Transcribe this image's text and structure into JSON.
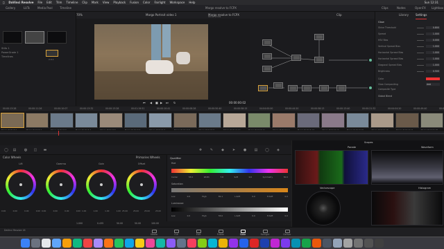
{
  "menubar": {
    "app": "DaVinci Resolve",
    "items": [
      "File",
      "Edit",
      "Trim",
      "Timeline",
      "Clip",
      "Mark",
      "View",
      "Playback",
      "Fusion",
      "Color",
      "Fairlight",
      "Workspace",
      "Help"
    ],
    "clock": "Sun 12:31"
  },
  "window_title": "Margo resolve to FCPX",
  "toolbar": {
    "gallery": "Gallery",
    "luts": "LUTs",
    "media_pool": "Media Pool",
    "timeline": "Timeline",
    "clips": "Clips",
    "nodes": "Nodes",
    "openfx": "OpenFX",
    "lightbox": "Lightbox"
  },
  "viewer": {
    "zoom": "70%",
    "clip_name": "Margo Portrait video 1",
    "timecode_top": "00:01:13:29",
    "timecode": "00:00:00:02",
    "clip_label": "Clip"
  },
  "gallery": {
    "stills_label": "Stills 1",
    "items": [
      "PowerGrade 1",
      "Timelines"
    ],
    "clip_code": "2.0.1"
  },
  "settings": {
    "tab_library": "Library",
    "tab_settings": "Settings",
    "filter": "Glow",
    "rows": [
      {
        "label": "Shine Threshold",
        "value": "0.800"
      },
      {
        "label": "Spread",
        "value": "1.000"
      },
      {
        "label": "HSV Bias",
        "value": "0.000"
      },
      {
        "label": "Vertical Spread Bias",
        "value": "1.000"
      },
      {
        "label": "Horizontal Spread Bias",
        "value": "1.000"
      },
      {
        "label": "Horizontal Spread Bias",
        "value": "1.000"
      },
      {
        "label": "Diagonal Spread Bias",
        "value": "1.000"
      },
      {
        "label": "Brightness",
        "value": "0.500"
      }
    ],
    "color_label": "Color",
    "composite_label": "Glow Compositing",
    "composite_value": "Add",
    "blend_label": "Composite Type",
    "global_blend": "Global Blend"
  },
  "timeline_clips": [
    {
      "tc": "00:00:13:28",
      "name": "Margo Portrait 1"
    },
    {
      "tc": "00:00:11:26",
      "name": "Margo Portrait 2"
    },
    {
      "tc": "00:00:10:07",
      "name": "Margo Portrait 3"
    },
    {
      "tc": "00:00:13:32",
      "name": "Margo Portrait 4"
    },
    {
      "tc": "00:00:13:28",
      "name": "Margo Portrait 5"
    },
    {
      "tc": "00:01:19:51",
      "name": "Margo Portrait 6"
    },
    {
      "tc": "00:00:10:41",
      "name": "Margo Portrait 7"
    },
    {
      "tc": "00:00:08:28",
      "name": "Margo Portrait 8"
    },
    {
      "tc": "00:00:50:40",
      "name": "Margo Portrait 9"
    },
    {
      "tc": "00:00:58:15",
      "name": "Margo Portrait 10"
    },
    {
      "tc": "04:04:00:00",
      "name": "Margo Portrait 11"
    },
    {
      "tc": "00:00:44:20",
      "name": "Margo Portrait 12"
    },
    {
      "tc": "00:00:58:13",
      "name": "Margo Portrait 13"
    },
    {
      "tc": "00:00:13:40",
      "name": "Margo Portrait 14"
    },
    {
      "tc": "00:00:21:32",
      "name": "Margo Portrait 15"
    },
    {
      "tc": "00:04:04:20",
      "name": "Margo Portrait 16"
    },
    {
      "tc": "00:00:49:40",
      "name": "Margo Portrait 17"
    },
    {
      "tc": "00:00:14:00",
      "name": "Margo Portrait 18"
    }
  ],
  "color_wheels": {
    "title": "Color Wheels",
    "mode": "Primaries Wheels",
    "wheels": [
      {
        "name": "Lift",
        "vals": [
          "0.00",
          "0.00",
          "0.00",
          "0.00"
        ]
      },
      {
        "name": "Gamma",
        "vals": [
          "0.00",
          "0.00",
          "0.00",
          "0.00"
        ]
      },
      {
        "name": "Gain",
        "vals": [
          "1.00",
          "1.00",
          "1.00",
          "1.00"
        ]
      },
      {
        "name": "Offset",
        "vals": [
          "25.00",
          "25.00",
          "25.00",
          "25.00"
        ]
      }
    ],
    "bottom": {
      "contrast": "1.000",
      "pivot": "0.435",
      "sat": "50.00",
      "hue": "50.00",
      "lum_mix": "100.00"
    }
  },
  "qualifier": {
    "title": "Qualifier",
    "hue_label": "Hue",
    "hue_vals": [
      "Center",
      "55.5",
      "Width",
      "7.8",
      "Soft",
      "0.0",
      "Symmetry",
      "50.0"
    ],
    "sat_label": "Saturation",
    "sat_vals": [
      "Low",
      "0.0",
      "High",
      "81.1",
      "L.Soft",
      "0.0",
      "H.Soft",
      "0.0"
    ],
    "lum_label": "Luminance",
    "lum_vals": [
      "Low",
      "0.0",
      "High",
      "55.6",
      "L.Soft",
      "0.0",
      "H.Soft",
      "0.0"
    ]
  },
  "scopes": {
    "title": "Scopes",
    "parade": "Parade",
    "waveform": "Waveform",
    "vectorscope": "Vectorscope",
    "histogram": "Histogram"
  },
  "pages": [
    "Media",
    "Cut",
    "Edit",
    "Fusion",
    "Color",
    "Fairlight",
    "Deliver"
  ],
  "active_page": "Color",
  "project_footer": "DaVinci Resolve 16",
  "dock_colors": [
    "#3b82f6",
    "#6b7280",
    "#e5e7eb",
    "#60a5fa",
    "#f59e0b",
    "#10b981",
    "#ef4444",
    "#a78bfa",
    "#f97316",
    "#22c55e",
    "#0ea5e9",
    "#facc15",
    "#ec4899",
    "#14b8a6",
    "#8b5cf6",
    "#64748b",
    "#f43f5e",
    "#84cc16",
    "#06b6d4",
    "#eab308",
    "#9333ea",
    "#2563eb",
    "#dc2626",
    "#1e40af",
    "#c026d3",
    "#7c3aed",
    "#0891b2",
    "#16a34a",
    "#ea580c",
    "#4b5563",
    "#94a3b8",
    "#a3a3a3",
    "#737373",
    "#525252",
    "#404040"
  ]
}
